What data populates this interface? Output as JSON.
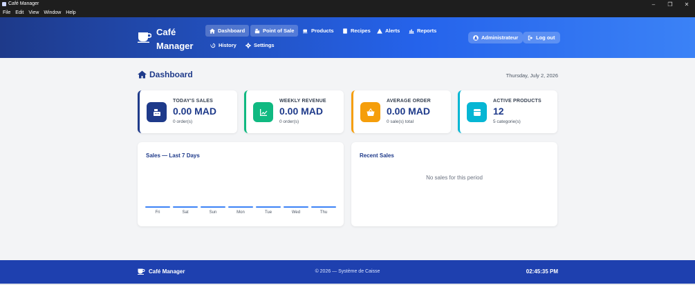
{
  "window": {
    "title": "Café Manager",
    "controls": [
      "–",
      "❐",
      "✕"
    ]
  },
  "menu": [
    "File",
    "Edit",
    "View",
    "Window",
    "Help"
  ],
  "brand": {
    "line1": "Café",
    "line2": "Manager"
  },
  "nav": {
    "dashboard": "Dashboard",
    "pos": "Point of Sale",
    "products": "Products",
    "recipes": "Recipes",
    "alerts": "Alerts",
    "reports": "Reports",
    "history": "History",
    "settings": "Settings"
  },
  "user": {
    "role": "Administrateur",
    "logout": "Log out"
  },
  "page": {
    "title": "Dashboard",
    "date": "Thursday, July 2, 2026"
  },
  "cards": [
    {
      "label": "TODAY'S SALES",
      "value": "0.00 MAD",
      "sub": "0 order(s)",
      "color": "#1e3a8a",
      "icon": "cash-register-icon"
    },
    {
      "label": "WEEKLY REVENUE",
      "value": "0.00 MAD",
      "sub": "0 order(s)",
      "color": "#10b981",
      "icon": "chart-line-icon"
    },
    {
      "label": "AVERAGE ORDER",
      "value": "0.00 MAD",
      "sub": "0 sale(s) total",
      "color": "#f59e0b",
      "icon": "basket-icon"
    },
    {
      "label": "ACTIVE PRODUCTS",
      "value": "12",
      "sub": "5 categorie(s)",
      "color": "#06b6d4",
      "icon": "box-icon"
    }
  ],
  "sales_panel": {
    "title": "Sales — Last 7 Days",
    "days": [
      "Fri",
      "Sat",
      "Sun",
      "Mon",
      "Tue",
      "Wed",
      "Thu"
    ]
  },
  "chart_data": {
    "type": "bar",
    "categories": [
      "Fri",
      "Sat",
      "Sun",
      "Mon",
      "Tue",
      "Wed",
      "Thu"
    ],
    "values": [
      0,
      0,
      0,
      0,
      0,
      0,
      0
    ],
    "title": "Sales — Last 7 Days",
    "xlabel": "",
    "ylabel": ""
  },
  "recent_panel": {
    "title": "Recent Sales",
    "empty": "No sales for this period"
  },
  "footer": {
    "brand": "Café Manager",
    "copyright": "© 2026 — Système de Caisse",
    "time": "02:45:35 PM"
  },
  "colors": {
    "header_start": "#1e3a8a",
    "header_end": "#3b82f6",
    "footer": "#1e40af",
    "accent": "#3b82f6"
  }
}
